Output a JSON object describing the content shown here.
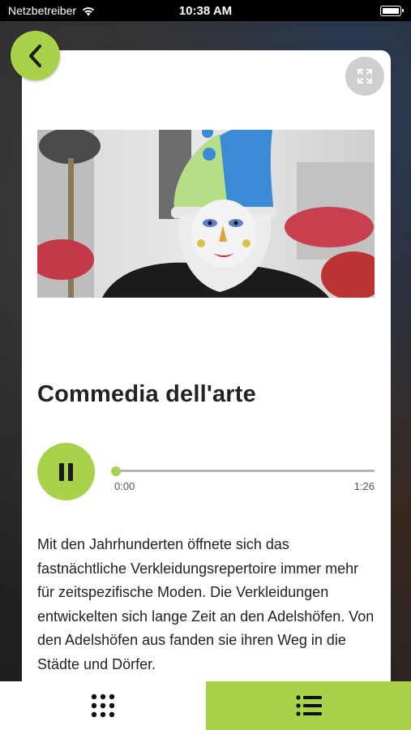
{
  "status_bar": {
    "carrier": "Netzbetreiber",
    "time": "10:38 AM"
  },
  "icons": {
    "back": "chevron-left-icon",
    "expand": "expand-icon",
    "pause": "pause-icon",
    "grid": "grid-icon",
    "list": "list-icon"
  },
  "article": {
    "title": "Commedia dell'arte",
    "body": "Mit den Jahrhunderten öffnete sich das fastnächtliche Verkleidungsrepertoire immer mehr für zeitspezifische Moden. Die Verkleidungen entwickelten sich lange Zeit an den Adelshöfen. Von den Adelshöfen aus fanden sie ihren Weg in die Städte und Dörfer."
  },
  "player": {
    "current_time": "0:00",
    "total_time": "1:26",
    "progress": 0.0
  },
  "colors": {
    "accent": "#a8d24a",
    "text": "#222222"
  }
}
